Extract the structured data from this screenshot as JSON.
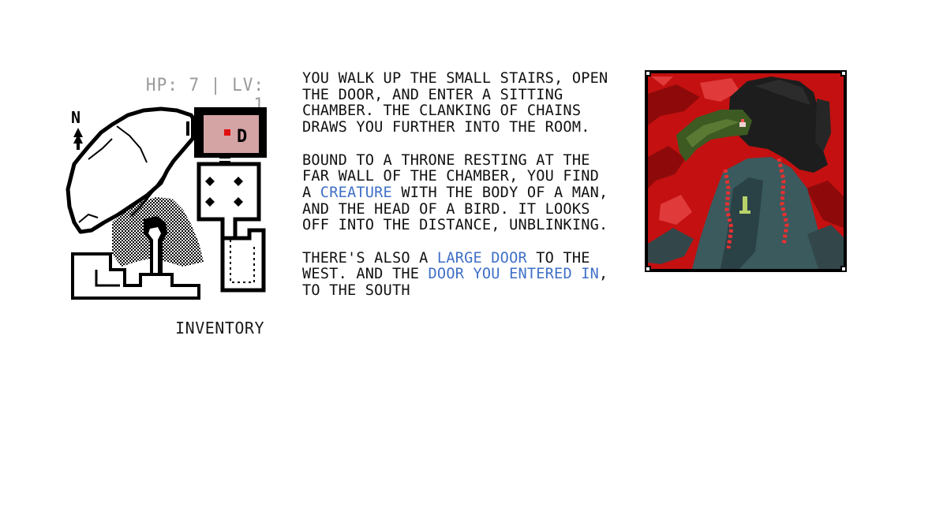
{
  "stats": {
    "hp_text": "HP: 7 | LV: 1"
  },
  "map": {
    "compass_letter": "N",
    "current_room_marker": "D"
  },
  "inventory_label": "INVENTORY",
  "story": {
    "p1": "YOU WALK UP THE SMALL STAIRS, OPEN\nTHE DOOR, AND ENTER A SITTING\nCHAMBER. THE CLANKING OF CHAINS\nDRAWS YOU FURTHER INTO THE ROOM.",
    "p2_before": "BOUND TO A THRONE RESTING AT THE\nFAR WALL OF THE CHAMBER, YOU FIND\nA ",
    "p2_link": "CREATURE",
    "p2_after": " WITH THE BODY OF A MAN,\nAND THE HEAD OF A BIRD. IT LOOKS\nOFF INTO THE DISTANCE, UNBLINKING.",
    "p3_before": "THERE'S ALSO A ",
    "p3_link1": "LARGE DOOR",
    "p3_middle": " TO THE\nWEST. AND THE ",
    "p3_link2": "DOOR YOU ENTERED IN",
    "p3_after": ",\nTO THE SOUTH"
  },
  "colors": {
    "link": "#3f6fc6",
    "stats_text": "#9a9a9a",
    "current_room_fill": "#d4a3a3",
    "current_room_dot": "#e01010",
    "portrait_background": "#c41010",
    "creature_robe": "#3a5a5e",
    "beak": "#3c5a22"
  },
  "icons": {
    "compass": "compass-arrow-icon",
    "player": "player-position-icon",
    "portrait": "bird-headed-creature-portrait"
  }
}
